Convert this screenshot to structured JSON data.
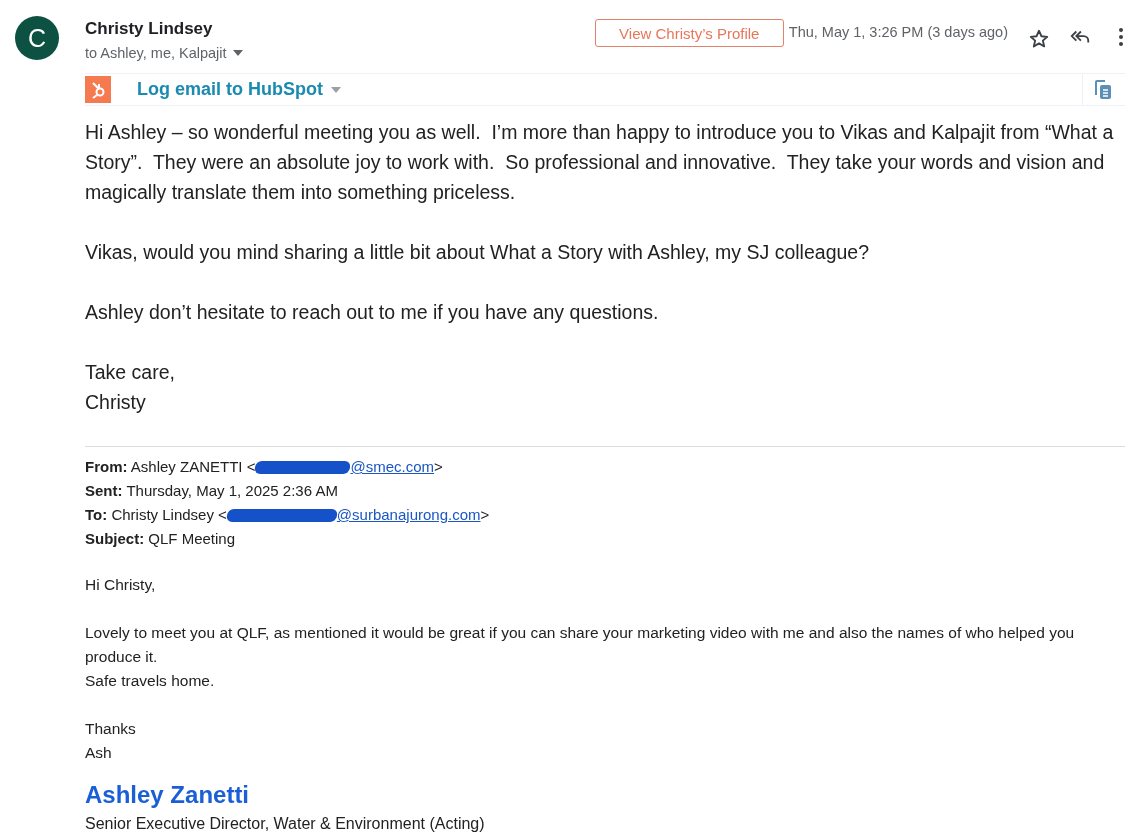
{
  "sender": {
    "avatar_letter": "C",
    "name": "Christy Lindsey",
    "recipients": "to Ashley, me, Kalpajit"
  },
  "profile_button": "View Christy’s Profile",
  "date": "Thu, May 1, 3:26 PM (3 days ago)",
  "starred": false,
  "hubspot": {
    "label": "Log email to HubSpot"
  },
  "body": [
    [
      "Hi Ashley – so wonderful meeting you as well.  I’m more than happy to introduce you to Vikas and Kalpajit from “What a Story”.  They were an absolute joy to work with.  So professional and innovative.  They take your words and vision and magically translate them into something priceless."
    ],
    [
      "Vikas, would you mind sharing a little bit about What a Story with Ashley, my SJ colleague?"
    ],
    [
      "Ashley don’t hesitate to reach out to me if you have any questions."
    ],
    [
      "Take care,",
      "Christy"
    ]
  ],
  "quoted": {
    "headers": [
      {
        "label": "From:",
        "value": "Ashley ZANETTI <",
        "redacted": true,
        "link": "@smec.com",
        "after": ">"
      },
      {
        "label": "Sent:",
        "value": "Thursday, May 1, 2025 2:36 AM"
      },
      {
        "label": "To:",
        "value": "Christy Lindsey <",
        "redacted": true,
        "link": "@surbanajurong.com",
        "after": ">"
      },
      {
        "label": "Subject:",
        "value": "QLF Meeting"
      }
    ],
    "body": [
      [
        "Hi Christy,"
      ],
      [
        "Lovely to meet you at QLF, as mentioned it would be great if you can share your marketing video with me and also the names of who helped you produce it.",
        "Safe travels home."
      ],
      [
        "Thanks",
        "Ash"
      ]
    ],
    "signature": {
      "name": "Ashley Zanetti",
      "title": "Senior Executive Director, Water & Environment (Acting)"
    }
  }
}
